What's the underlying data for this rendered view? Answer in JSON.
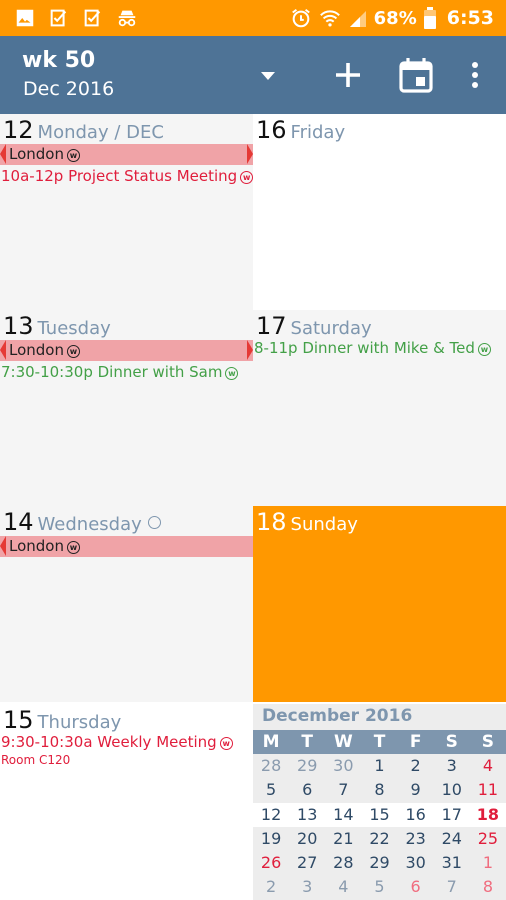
{
  "status_bar": {
    "battery": "68%",
    "time": "6:53",
    "left_icons": [
      "gallery-icon",
      "task-check-icon",
      "task-check-icon",
      "incognito-icon"
    ],
    "right_icons": [
      "alarm-icon",
      "wifi-icon",
      "signal-icon",
      "battery-icon"
    ]
  },
  "app_bar": {
    "week": "wk 50",
    "month": "Dec 2016",
    "actions": [
      "dropdown-icon",
      "add-icon",
      "calendar-today-icon",
      "more-vert-icon"
    ]
  },
  "days": {
    "mon": {
      "num": "12",
      "name": "Monday / DEC",
      "allday": "London",
      "events": [
        {
          "text": "10a-12p Project Status Meeting"
        }
      ]
    },
    "tue": {
      "num": "13",
      "name": "Tuesday",
      "allday": "London",
      "events": [
        {
          "text": "7:30-10:30p Dinner with Sam"
        }
      ]
    },
    "wed": {
      "num": "14",
      "name": "Wednesday",
      "allday": "London"
    },
    "thu": {
      "num": "15",
      "name": "Thursday",
      "events": [
        {
          "text": "9:30-10:30a Weekly Meeting",
          "sub": "Room C120"
        }
      ]
    },
    "fri": {
      "num": "16",
      "name": "Friday"
    },
    "sat": {
      "num": "17",
      "name": "Saturday",
      "events": [
        {
          "text": "8-11p Dinner with Mike & Ted"
        }
      ]
    },
    "sun": {
      "num": "18",
      "name": "Sunday"
    }
  },
  "mini_month": {
    "title": "December 2016",
    "weekdays": [
      "M",
      "T",
      "W",
      "T",
      "F",
      "S",
      "S"
    ],
    "weeks": [
      [
        "28",
        "29",
        "30",
        "1",
        "2",
        "3",
        "4"
      ],
      [
        "5",
        "6",
        "7",
        "8",
        "9",
        "10",
        "11"
      ],
      [
        "12",
        "13",
        "14",
        "15",
        "16",
        "17",
        "18"
      ],
      [
        "19",
        "20",
        "21",
        "22",
        "23",
        "24",
        "25"
      ],
      [
        "26",
        "27",
        "28",
        "29",
        "30",
        "31",
        "1"
      ],
      [
        "2",
        "3",
        "4",
        "5",
        "6",
        "7",
        "8"
      ]
    ]
  },
  "colors": {
    "accent": "#FF9800",
    "toolbar": "#4E7396",
    "event_red": "#E01E3C",
    "event_green": "#43A047",
    "allday_bg": "#F0A3A7"
  }
}
